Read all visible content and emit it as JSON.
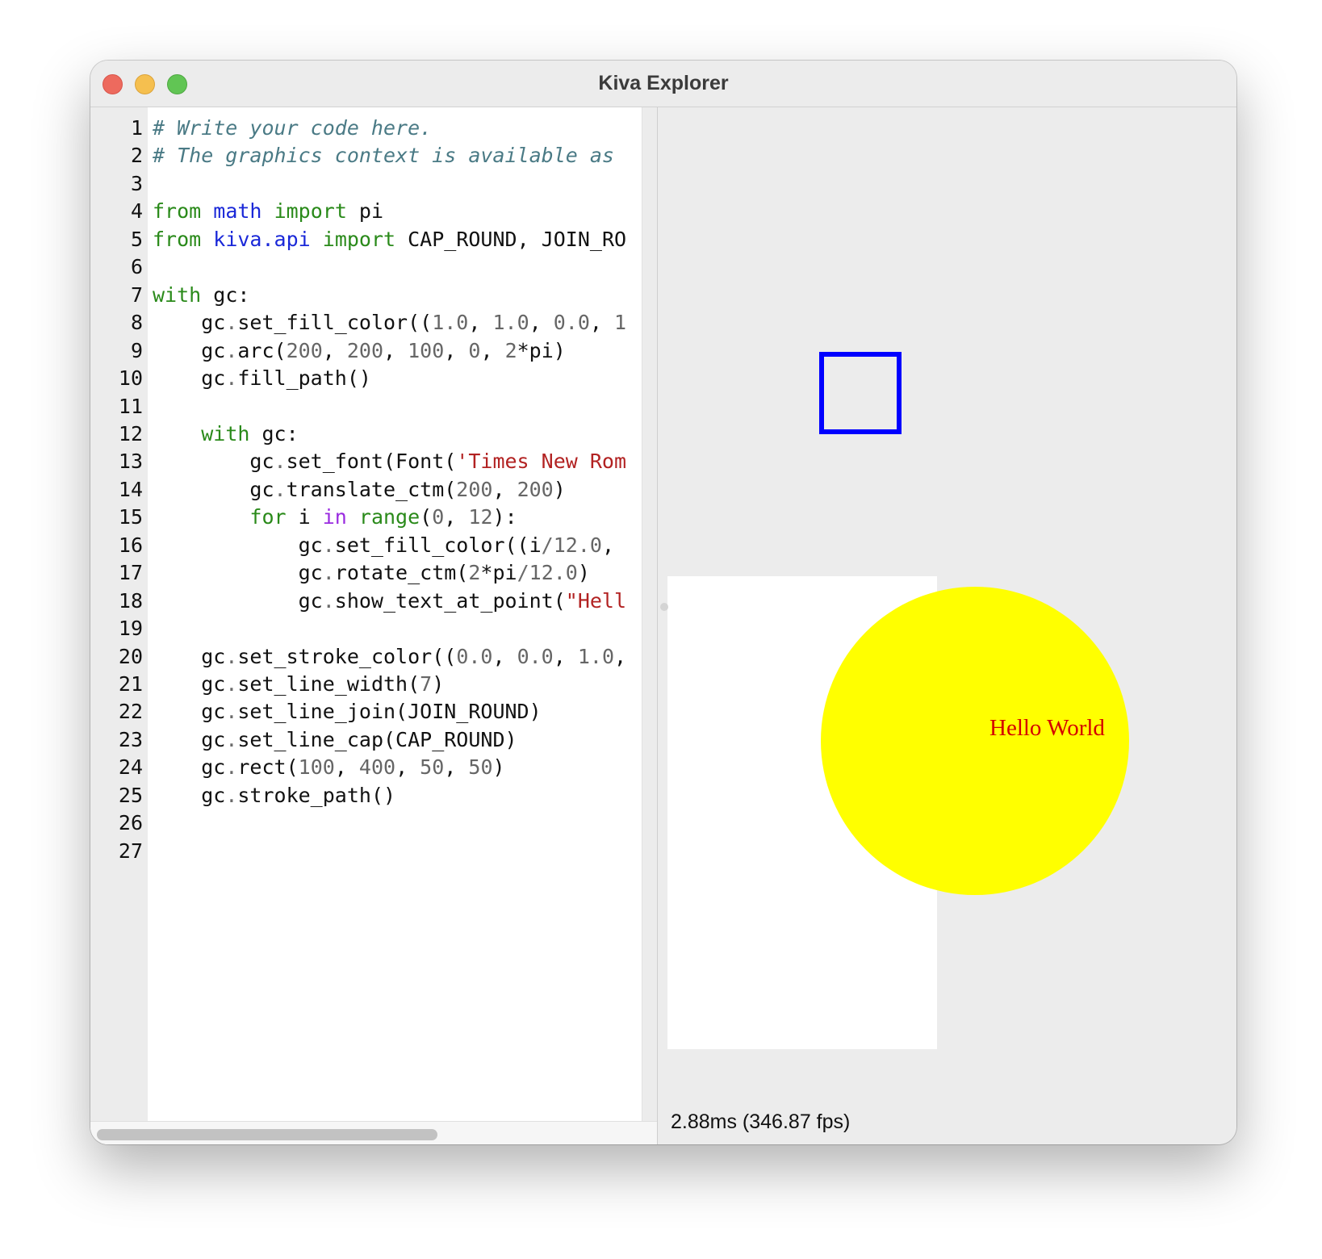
{
  "window": {
    "title": "Kiva Explorer"
  },
  "editor": {
    "line_numbers": [
      "1",
      "2",
      "3",
      "4",
      "5",
      "6",
      "7",
      "8",
      "9",
      "10",
      "11",
      "12",
      "13",
      "14",
      "15",
      "16",
      "17",
      "18",
      "19",
      "20",
      "21",
      "22",
      "23",
      "24",
      "25",
      "26",
      "27"
    ],
    "lines": [
      [
        {
          "t": "# Write your code here.",
          "c": "cm"
        }
      ],
      [
        {
          "t": "# The graphics context is available as",
          "c": "cm"
        }
      ],
      [],
      [
        {
          "t": "from",
          "c": "kw"
        },
        {
          "t": " "
        },
        {
          "t": "math",
          "c": "mod"
        },
        {
          "t": " "
        },
        {
          "t": "import",
          "c": "kw"
        },
        {
          "t": " pi"
        }
      ],
      [
        {
          "t": "from",
          "c": "kw"
        },
        {
          "t": " "
        },
        {
          "t": "kiva.api",
          "c": "mod"
        },
        {
          "t": " "
        },
        {
          "t": "import",
          "c": "kw"
        },
        {
          "t": " CAP_ROUND, JOIN_RO"
        }
      ],
      [],
      [
        {
          "t": "with",
          "c": "kw"
        },
        {
          "t": " gc:"
        }
      ],
      [
        {
          "t": "    gc"
        },
        {
          "t": ".",
          "c": "op"
        },
        {
          "t": "set_fill_color(("
        },
        {
          "t": "1.0",
          "c": "num"
        },
        {
          "t": ", "
        },
        {
          "t": "1.0",
          "c": "num"
        },
        {
          "t": ", "
        },
        {
          "t": "0.0",
          "c": "num"
        },
        {
          "t": ", "
        },
        {
          "t": "1",
          "c": "num"
        }
      ],
      [
        {
          "t": "    gc"
        },
        {
          "t": ".",
          "c": "op"
        },
        {
          "t": "arc("
        },
        {
          "t": "200",
          "c": "num"
        },
        {
          "t": ", "
        },
        {
          "t": "200",
          "c": "num"
        },
        {
          "t": ", "
        },
        {
          "t": "100",
          "c": "num"
        },
        {
          "t": ", "
        },
        {
          "t": "0",
          "c": "num"
        },
        {
          "t": ", "
        },
        {
          "t": "2",
          "c": "num"
        },
        {
          "t": "*pi)"
        }
      ],
      [
        {
          "t": "    gc"
        },
        {
          "t": ".",
          "c": "op"
        },
        {
          "t": "fill_path()"
        }
      ],
      [],
      [
        {
          "t": "    "
        },
        {
          "t": "with",
          "c": "kw"
        },
        {
          "t": " gc:"
        }
      ],
      [
        {
          "t": "        gc"
        },
        {
          "t": ".",
          "c": "op"
        },
        {
          "t": "set_font(Font("
        },
        {
          "t": "'Times New Rom",
          "c": "str"
        }
      ],
      [
        {
          "t": "        gc"
        },
        {
          "t": ".",
          "c": "op"
        },
        {
          "t": "translate_ctm("
        },
        {
          "t": "200",
          "c": "num"
        },
        {
          "t": ", "
        },
        {
          "t": "200",
          "c": "num"
        },
        {
          "t": ")"
        }
      ],
      [
        {
          "t": "        "
        },
        {
          "t": "for",
          "c": "kw"
        },
        {
          "t": " i "
        },
        {
          "t": "in",
          "c": "bi"
        },
        {
          "t": " "
        },
        {
          "t": "range",
          "c": "kw"
        },
        {
          "t": "("
        },
        {
          "t": "0",
          "c": "num"
        },
        {
          "t": ", "
        },
        {
          "t": "12",
          "c": "num"
        },
        {
          "t": "):"
        }
      ],
      [
        {
          "t": "            gc"
        },
        {
          "t": ".",
          "c": "op"
        },
        {
          "t": "set_fill_color((i"
        },
        {
          "t": "/",
          "c": "op"
        },
        {
          "t": "12.0",
          "c": "num"
        },
        {
          "t": ","
        }
      ],
      [
        {
          "t": "            gc"
        },
        {
          "t": ".",
          "c": "op"
        },
        {
          "t": "rotate_ctm("
        },
        {
          "t": "2",
          "c": "num"
        },
        {
          "t": "*pi"
        },
        {
          "t": "/",
          "c": "op"
        },
        {
          "t": "12.0",
          "c": "num"
        },
        {
          "t": ")"
        }
      ],
      [
        {
          "t": "            gc"
        },
        {
          "t": ".",
          "c": "op"
        },
        {
          "t": "show_text_at_point("
        },
        {
          "t": "\"Hell",
          "c": "str"
        }
      ],
      [],
      [
        {
          "t": "    gc"
        },
        {
          "t": ".",
          "c": "op"
        },
        {
          "t": "set_stroke_color(("
        },
        {
          "t": "0.0",
          "c": "num"
        },
        {
          "t": ", "
        },
        {
          "t": "0.0",
          "c": "num"
        },
        {
          "t": ", "
        },
        {
          "t": "1.0",
          "c": "num"
        },
        {
          "t": ","
        }
      ],
      [
        {
          "t": "    gc"
        },
        {
          "t": ".",
          "c": "op"
        },
        {
          "t": "set_line_width("
        },
        {
          "t": "7",
          "c": "num"
        },
        {
          "t": ")"
        }
      ],
      [
        {
          "t": "    gc"
        },
        {
          "t": ".",
          "c": "op"
        },
        {
          "t": "set_line_join(JOIN_ROUND)"
        }
      ],
      [
        {
          "t": "    gc"
        },
        {
          "t": ".",
          "c": "op"
        },
        {
          "t": "set_line_cap(CAP_ROUND)"
        }
      ],
      [
        {
          "t": "    gc"
        },
        {
          "t": ".",
          "c": "op"
        },
        {
          "t": "rect("
        },
        {
          "t": "100",
          "c": "num"
        },
        {
          "t": ", "
        },
        {
          "t": "400",
          "c": "num"
        },
        {
          "t": ", "
        },
        {
          "t": "50",
          "c": "num"
        },
        {
          "t": ", "
        },
        {
          "t": "50",
          "c": "num"
        },
        {
          "t": ")"
        }
      ],
      [
        {
          "t": "    gc"
        },
        {
          "t": ".",
          "c": "op"
        },
        {
          "t": "stroke_path()"
        }
      ],
      [],
      []
    ]
  },
  "preview": {
    "canvas_text": "Hello World",
    "text_color": "#d40000",
    "circle_color": "#ffff00",
    "square_stroke_color": "#0000ff",
    "status": "2.88ms (346.87 fps)"
  },
  "colors": {
    "window_bg": "#ececec",
    "comment": "#4a7a85",
    "keyword": "#2a8a1a",
    "module": "#1a28d8",
    "number": "#666666",
    "string": "#b22222",
    "builtin": "#9a2be0"
  }
}
